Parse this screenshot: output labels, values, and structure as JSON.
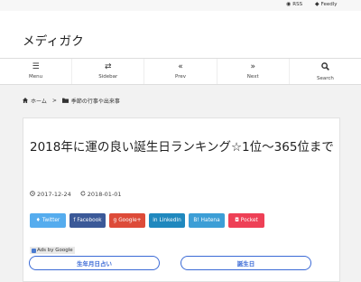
{
  "topbar": {
    "rss": {
      "icon": "rss-icon",
      "label": "RSS"
    },
    "feedly": {
      "icon": "feedly-icon",
      "label": "Feedly"
    }
  },
  "site": {
    "title": "メディガク"
  },
  "nav": {
    "items": [
      {
        "icon": "menu-icon",
        "label": "Menu"
      },
      {
        "icon": "sidebar-icon",
        "label": "Sidebar"
      },
      {
        "icon": "prev-icon",
        "label": "Prev"
      },
      {
        "icon": "next-icon",
        "label": "Next"
      },
      {
        "icon": "search-icon",
        "label": "Search"
      }
    ]
  },
  "breadcrumb": {
    "home": "ホーム",
    "separator": ">",
    "category": "季節の行事や出来事"
  },
  "post": {
    "title": "2018年に運の良い誕生日ランキング☆1位～365位まで",
    "published": "2017-12-24",
    "updated": "2018-01-01"
  },
  "share": {
    "buttons": [
      {
        "label": "Twitter",
        "icon": "twitter-icon",
        "color": "#55acee"
      },
      {
        "label": "Facebook",
        "icon": "facebook-icon",
        "color": "#3b5998"
      },
      {
        "label": "Google+",
        "icon": "googleplus-icon",
        "color": "#dd4b39"
      },
      {
        "label": "LinkedIn",
        "icon": "linkedin-icon",
        "color": "#1f88be"
      },
      {
        "label": "Hatena",
        "icon": "hatena-icon",
        "color": "#3c9ed6"
      },
      {
        "label": "Pocket",
        "icon": "pocket-icon",
        "color": "#ee4056"
      }
    ]
  },
  "ads": {
    "label": "Ads by Google",
    "links": [
      "生年月日占い",
      "誕生日"
    ]
  }
}
